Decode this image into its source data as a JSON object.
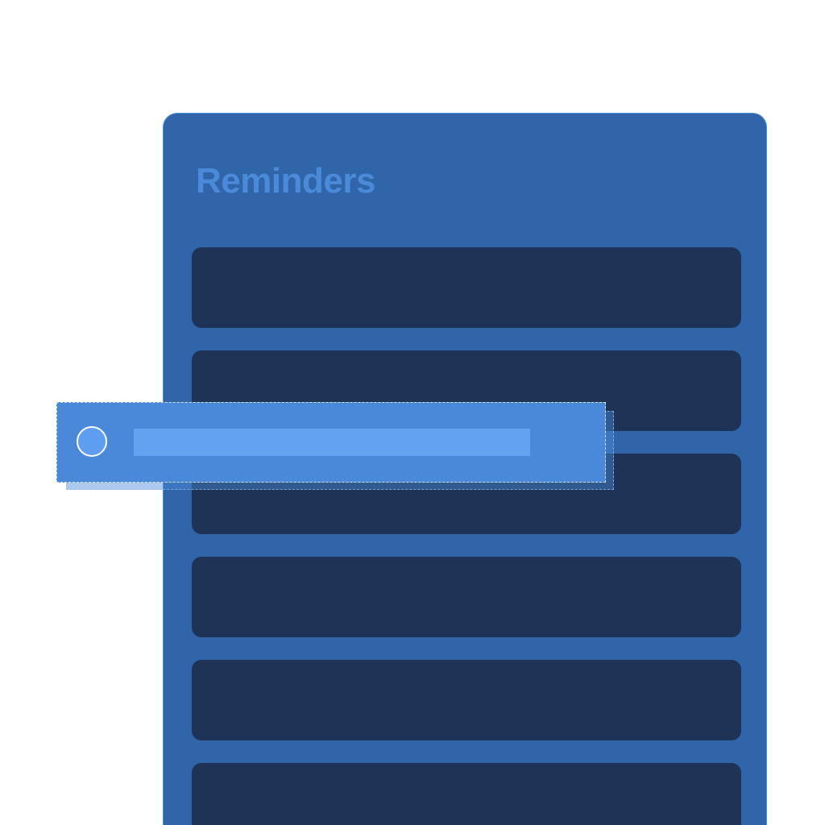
{
  "app": {
    "title": "Reminders"
  },
  "colors": {
    "panel": "#3066a9",
    "title_text": "#4a8ad8",
    "row": "#1e3356",
    "drag_item": "#4a89da",
    "drag_text_bar": "#62a2ee",
    "drag_checkbox": "#5e9ef0"
  },
  "reminders": {
    "row_count": 6,
    "dragged_item": {
      "checked": false
    }
  }
}
